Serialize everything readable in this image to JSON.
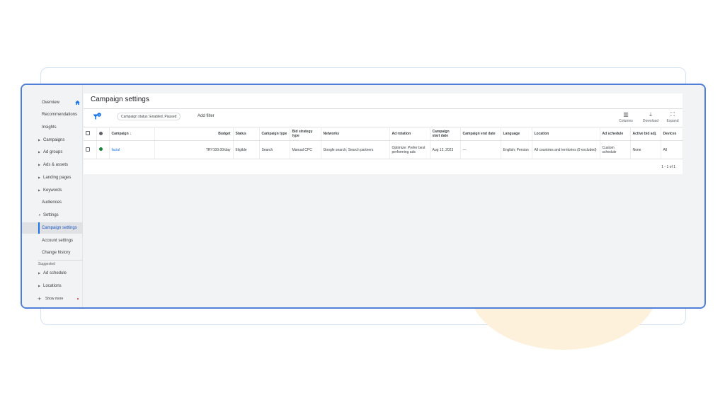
{
  "sidebar": {
    "items": [
      {
        "label": "Overview",
        "type": "plain"
      },
      {
        "label": "Recommendations",
        "type": "plain"
      },
      {
        "label": "Insights",
        "type": "plain"
      },
      {
        "label": "Campaigns",
        "type": "expand"
      },
      {
        "label": "Ad groups",
        "type": "expand"
      },
      {
        "label": "Ads & assets",
        "type": "expand"
      },
      {
        "label": "Landing pages",
        "type": "expand"
      },
      {
        "label": "Keywords",
        "type": "expand"
      },
      {
        "label": "Audiences",
        "type": "plain"
      },
      {
        "label": "Settings",
        "type": "expand-open"
      },
      {
        "label": "Campaign settings",
        "type": "active"
      },
      {
        "label": "Account settings",
        "type": "plain"
      },
      {
        "label": "Change history",
        "type": "plain"
      }
    ],
    "suggested_label": "Suggested",
    "suggested_items": [
      {
        "label": "Ad schedule"
      },
      {
        "label": "Locations"
      }
    ],
    "show_more": "Show more"
  },
  "header": {
    "title": "Campaign settings",
    "filter_badge": "1",
    "filter_chip": "Campaign status: Enabled, Paused",
    "add_filter": "Add filter"
  },
  "toolbar": {
    "columns": "Columns",
    "download": "Download",
    "expand": "Expand"
  },
  "table": {
    "headers": {
      "campaign": "Campaign",
      "sort_indicator": "↓",
      "budget": "Budget",
      "status": "Status",
      "campaign_type": "Campaign type",
      "bid_strategy": "Bid strategy type",
      "networks": "Networks",
      "ad_rotation": "Ad rotation",
      "start_date": "Campaign start date",
      "end_date": "Campaign end date",
      "language": "Language",
      "location": "Location",
      "ad_schedule": "Ad schedule",
      "active_bid_adj": "Active bid adj.",
      "devices": "Devices"
    },
    "row": {
      "campaign": "facial",
      "budget": "TRY100.00/day",
      "status": "Eligible",
      "campaign_type": "Search",
      "bid_strategy": "Manual CPC",
      "networks": "Google search; Search partners",
      "ad_rotation": "Optimize: Prefer best performing ads",
      "start_date": "Aug 12, 2023",
      "end_date": "—",
      "language": "English; Persian",
      "location": "All countries and territories (9 excluded)",
      "ad_schedule": "Custom schedule",
      "active_bid_adj": "None",
      "devices": "All"
    },
    "pagination": "1 - 1 of 1"
  },
  "colors": {
    "accent": "#1a73e8",
    "window_border": "#4f7fd9",
    "eligible_dot": "#188038",
    "background": "#f1f3f4"
  }
}
